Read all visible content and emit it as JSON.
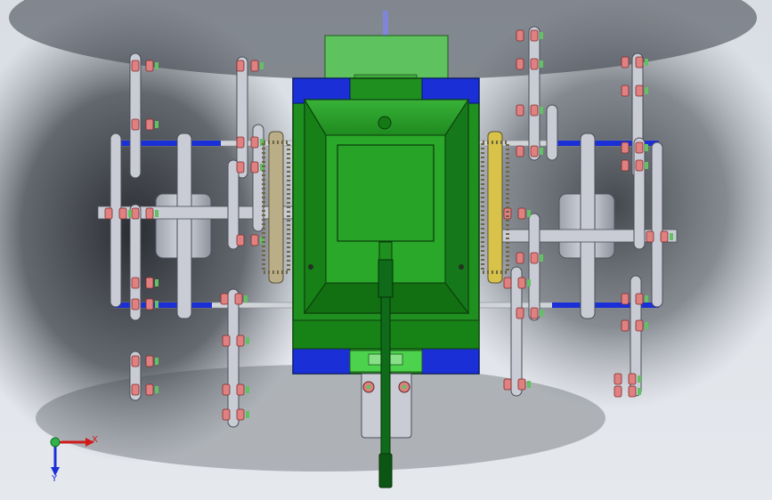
{
  "viewport": {
    "background_top": "#d8dde3",
    "background_bottom": "#e6e9ee",
    "shadow_color": "#1c1f24"
  },
  "model": {
    "name": "",
    "colors": {
      "body": "#1f8f1f",
      "body_dark": "#0f5f0f",
      "body_light": "#3fbf3f",
      "top_block": "#5ec25e",
      "blue_corner": "#1b2fd6",
      "rod": "#d0d4d8",
      "rod_blue": "#1b2fd6",
      "link": "#c9ccd4",
      "link_edge": "#4b4e59",
      "bolt": "#e08080",
      "bolt_edge": "#7b2c2c",
      "nut_green": "#62c262",
      "gear": "#b9ae88",
      "gear_yellow": "#d8c24a",
      "drum": "#bfc3cc",
      "handle": "#0f6a1a"
    }
  },
  "triad": {
    "x_label": "X",
    "y_label": "Y",
    "x_color": "#d11a1a",
    "y_color": "#1b2fd6",
    "origin_color": "#2fb24a"
  }
}
